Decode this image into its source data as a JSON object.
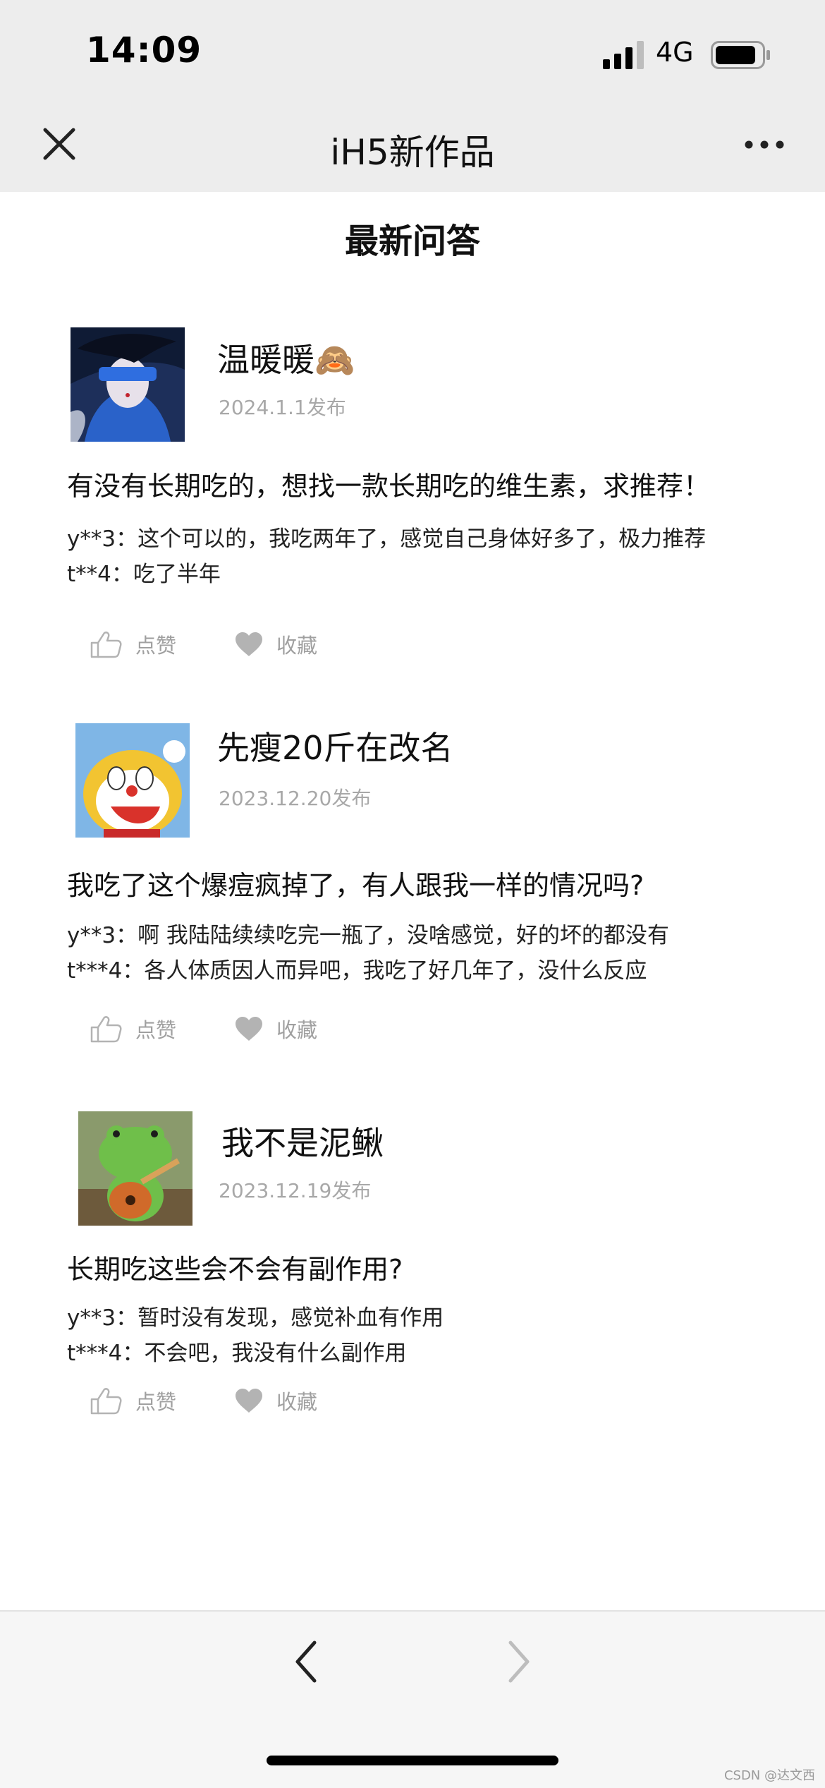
{
  "status_bar": {
    "time": "14:09",
    "network": "4G"
  },
  "nav": {
    "title": "iH5新作品"
  },
  "section": {
    "title": "最新问答"
  },
  "actions": {
    "like_label": "点赞",
    "favorite_label": "收藏"
  },
  "posts": [
    {
      "username": "温暖暖🙈",
      "date": "2024.1.1发布",
      "question": "有没有长期吃的，想找一款长期吃的维生素，求推荐！",
      "replies": [
        "y**3：这个可以的，我吃两年了，感觉自己身体好多了，极力推荐",
        "t**4：吃了半年"
      ]
    },
    {
      "username": "先瘦20斤在改名",
      "date": "2023.12.20发布",
      "question": "我吃了这个爆痘疯掉了，有人跟我一样的情况吗?",
      "replies": [
        "y**3：啊 我陆陆续续吃完一瓶了，没啥感觉，好的坏的都没有",
        "t***4：各人体质因人而异吧，我吃了好几年了，没什么反应"
      ]
    },
    {
      "username": "我不是泥鳅",
      "date": "2023.12.19发布",
      "question": "长期吃这些会不会有副作用?",
      "replies": [
        "y**3：暂时没有发现，感觉补血有作用",
        "t***4：不会吧，我没有什么副作用"
      ]
    }
  ],
  "watermark": "CSDN @达文西"
}
